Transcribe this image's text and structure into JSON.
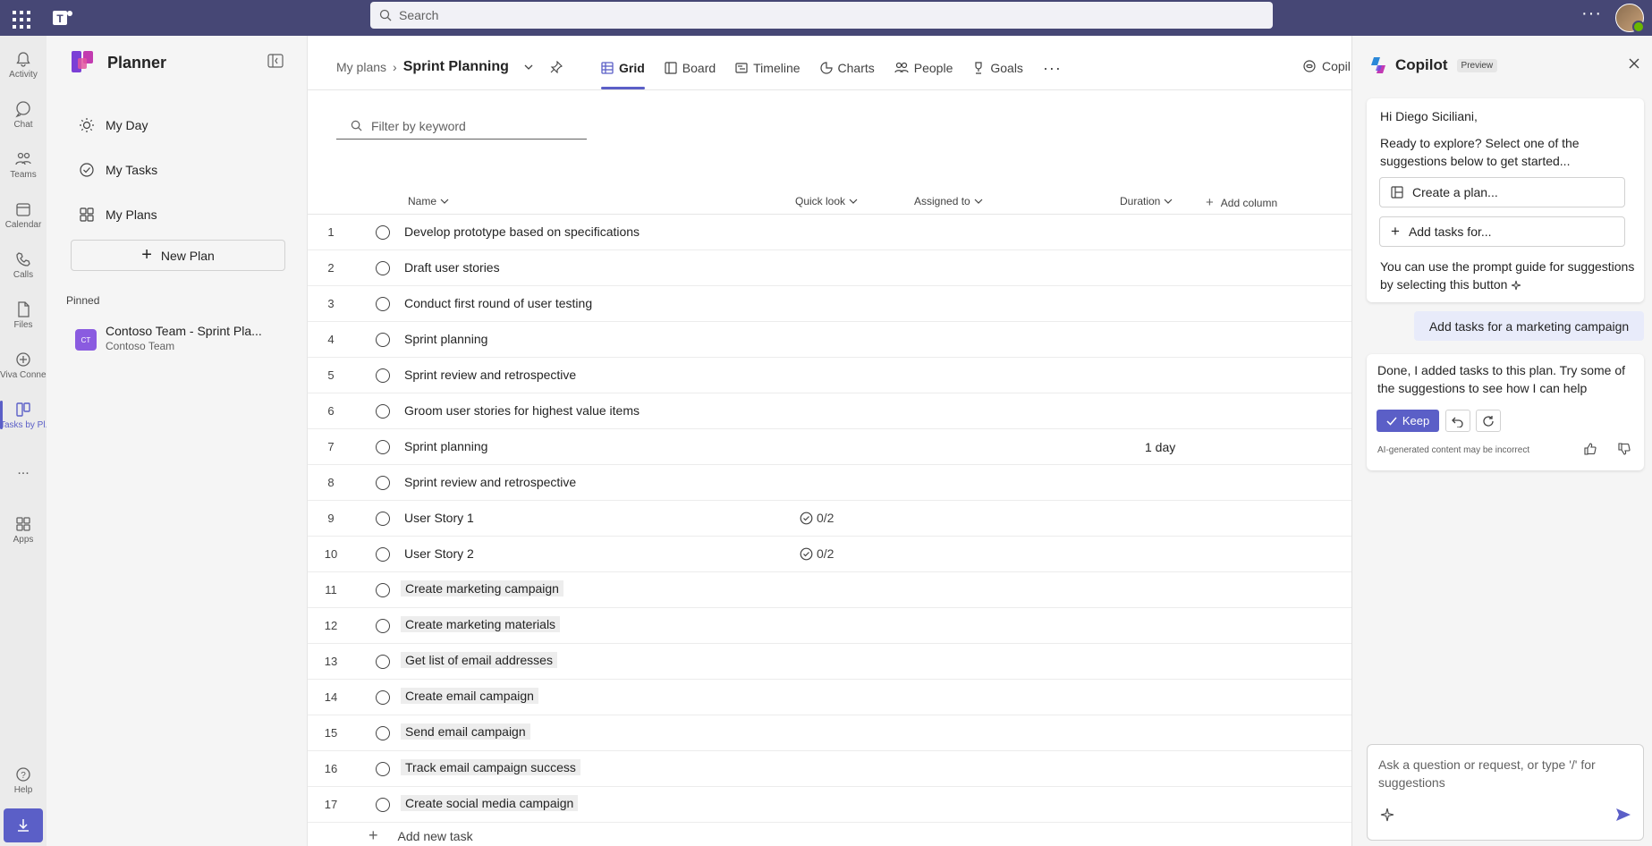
{
  "topbar": {
    "search_placeholder": "Search"
  },
  "rail": [
    {
      "label": "Activity",
      "icon": "bell-icon"
    },
    {
      "label": "Chat",
      "icon": "chat-icon"
    },
    {
      "label": "Teams",
      "icon": "teams-icon"
    },
    {
      "label": "Calendar",
      "icon": "calendar-icon"
    },
    {
      "label": "Calls",
      "icon": "phone-icon"
    },
    {
      "label": "Files",
      "icon": "file-icon"
    },
    {
      "label": "Viva Conne...",
      "icon": "viva-icon"
    },
    {
      "label": "Tasks by Pl...",
      "icon": "planner-icon"
    },
    {
      "label": "...",
      "icon": "more-icon"
    },
    {
      "label": "Apps",
      "icon": "apps-icon"
    },
    {
      "label": "Help",
      "icon": "help-icon"
    }
  ],
  "leftnav": {
    "title": "Planner",
    "items": [
      {
        "label": "My Day",
        "icon": "sun-icon"
      },
      {
        "label": "My Tasks",
        "icon": "tasks-icon"
      },
      {
        "label": "My Plans",
        "icon": "plans-grid-icon"
      }
    ],
    "new_plan": "New Plan",
    "pinned_label": "Pinned",
    "pinned": {
      "avatar": "CT",
      "title": "Contoso Team - Sprint Pla...",
      "subtitle": "Contoso Team"
    }
  },
  "header": {
    "crumb": "My plans",
    "current": "Sprint Planning",
    "tabs": [
      {
        "label": "Grid",
        "icon": "grid-icon",
        "active": true
      },
      {
        "label": "Board",
        "icon": "board-icon"
      },
      {
        "label": "Timeline",
        "icon": "timeline-icon"
      },
      {
        "label": "Charts",
        "icon": "charts-icon"
      },
      {
        "label": "People",
        "icon": "people-icon"
      },
      {
        "label": "Goals",
        "icon": "trophy-icon"
      }
    ],
    "more": "···",
    "copilot": "Copil"
  },
  "filter_placeholder": "Filter by keyword",
  "columns": {
    "name": "Name",
    "quick": "Quick look",
    "assigned": "Assigned to",
    "duration": "Duration",
    "add": "Add column"
  },
  "tasks": [
    {
      "n": "1",
      "name": "Develop prototype based on specifications",
      "hl": false,
      "quick": "",
      "dur": ""
    },
    {
      "n": "2",
      "name": "Draft user stories",
      "hl": false,
      "quick": "",
      "dur": ""
    },
    {
      "n": "3",
      "name": "Conduct first round of user testing",
      "hl": false,
      "quick": "",
      "dur": ""
    },
    {
      "n": "4",
      "name": "Sprint planning",
      "hl": false,
      "quick": "",
      "dur": ""
    },
    {
      "n": "5",
      "name": "Sprint review and retrospective",
      "hl": false,
      "quick": "",
      "dur": ""
    },
    {
      "n": "6",
      "name": "Groom user stories for highest value items",
      "hl": false,
      "quick": "",
      "dur": ""
    },
    {
      "n": "7",
      "name": "Sprint planning",
      "hl": false,
      "quick": "",
      "dur": "1 day"
    },
    {
      "n": "8",
      "name": "Sprint review and retrospective",
      "hl": false,
      "quick": "",
      "dur": ""
    },
    {
      "n": "9",
      "name": "User Story 1",
      "hl": false,
      "quick": "0/2",
      "dur": ""
    },
    {
      "n": "10",
      "name": "User Story 2",
      "hl": false,
      "quick": "0/2",
      "dur": ""
    },
    {
      "n": "11",
      "name": "Create marketing campaign",
      "hl": true,
      "quick": "",
      "dur": ""
    },
    {
      "n": "12",
      "name": "Create marketing materials",
      "hl": true,
      "quick": "",
      "dur": ""
    },
    {
      "n": "13",
      "name": "Get list of email addresses",
      "hl": true,
      "quick": "",
      "dur": ""
    },
    {
      "n": "14",
      "name": "Create email campaign",
      "hl": true,
      "quick": "",
      "dur": ""
    },
    {
      "n": "15",
      "name": "Send email campaign",
      "hl": true,
      "quick": "",
      "dur": ""
    },
    {
      "n": "16",
      "name": "Track email campaign success",
      "hl": true,
      "quick": "",
      "dur": ""
    },
    {
      "n": "17",
      "name": "Create social media campaign",
      "hl": true,
      "quick": "",
      "dur": ""
    }
  ],
  "add_task": "Add new task",
  "copilot": {
    "title": "Copilot",
    "badge": "Preview",
    "greeting": "Hi Diego Siciliani,",
    "intro": "Ready to explore? Select one of the suggestions below to get started...",
    "suggestions": [
      "Create a plan...",
      "Add tasks for..."
    ],
    "prompt_guide": "You can use the prompt guide for suggestions by selecting this button",
    "user_message": "Add tasks for a marketing campaign",
    "reply": "Done, I added tasks to this plan. Try some of the suggestions to see how I can help",
    "keep": "Keep",
    "disclaimer": "AI-generated content may be incorrect",
    "input_placeholder": "Ask a question or request, or type '/' for suggestions"
  },
  "colors": {
    "accent": "#5b5fc7",
    "topbar": "#464775"
  }
}
